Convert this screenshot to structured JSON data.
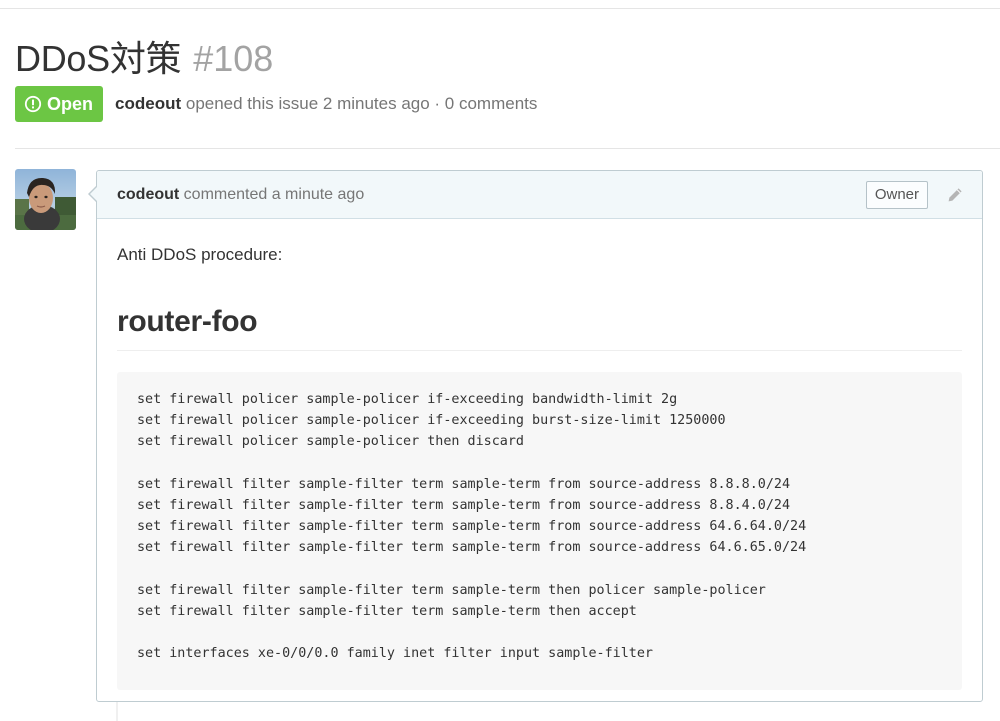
{
  "issue": {
    "title": "DDoS対策",
    "number": "#108",
    "state": "Open",
    "author": "codeout",
    "meta_text": "opened this issue 2 minutes ago · 0 comments"
  },
  "comment": {
    "author": "codeout",
    "header_text": "commented a minute ago",
    "role_badge": "Owner",
    "edit_icon": "pencil-icon",
    "intro": "Anti DDoS procedure:",
    "heading": "router-foo",
    "code_lines": [
      "set firewall policer sample-policer if-exceeding bandwidth-limit 2g",
      "set firewall policer sample-policer if-exceeding burst-size-limit 1250000",
      "set firewall policer sample-policer then discard",
      "",
      "set firewall filter sample-filter term sample-term from source-address 8.8.8.0/24",
      "set firewall filter sample-filter term sample-term from source-address 8.8.4.0/24",
      "set firewall filter sample-filter term sample-term from source-address 64.6.64.0/24",
      "set firewall filter sample-filter term sample-term from source-address 64.6.65.0/24",
      "",
      "set firewall filter sample-filter term sample-term then policer sample-policer",
      "set firewall filter sample-filter term sample-term then accept",
      "",
      "set interfaces xe-0/0/0.0 family inet filter input sample-filter"
    ]
  },
  "colors": {
    "open_badge": "#6cc644",
    "comment_header_bg": "#f2f8fa",
    "comment_border": "#bfccd1",
    "code_bg": "#f7f7f7",
    "muted_text": "#767676"
  },
  "icons": {
    "state": "issue-opened-icon",
    "avatar": "avatar-photo"
  }
}
